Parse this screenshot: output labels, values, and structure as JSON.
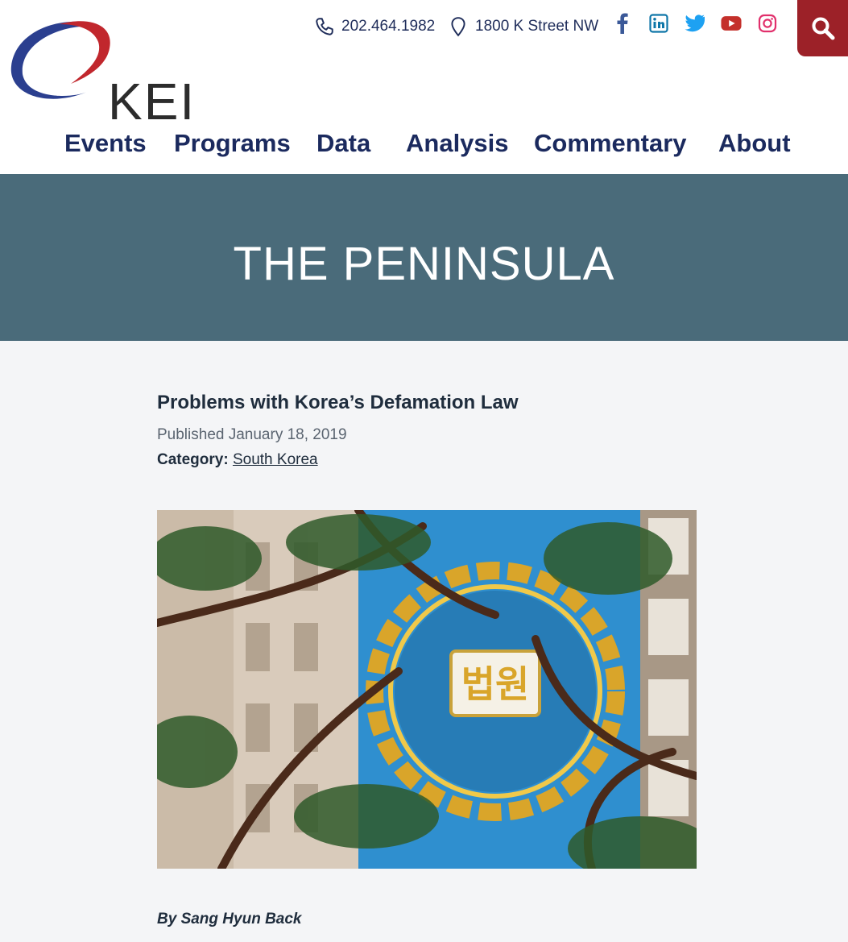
{
  "header": {
    "logo_text": "KEI",
    "phone": "202.464.1982",
    "address": "1800 K Street NW",
    "social": [
      "facebook-icon",
      "linkedin-icon",
      "twitter-icon",
      "youtube-icon",
      "instagram-icon"
    ]
  },
  "nav": {
    "events": "Events",
    "programs": "Programs",
    "data": "Data",
    "analysis": "Analysis",
    "commentary": "Commentary",
    "about": "About"
  },
  "banner": {
    "title": "THE PENINSULA"
  },
  "article": {
    "title": "Problems with Korea’s Defamation Law",
    "published": "Published January 18, 2019",
    "category_label": "Category:",
    "category_value": "South Korea",
    "byline": "By Sang Hyun Back",
    "image_sign_text": "법원"
  },
  "colors": {
    "accent_red": "#9c2128",
    "nav_blue": "#1b2a5e",
    "banner": "#4a6b7a",
    "facebook": "#3b5998",
    "linkedin": "#0e76a8",
    "twitter": "#1da1f2",
    "youtube": "#c4302b",
    "instagram": "#e1306c"
  }
}
